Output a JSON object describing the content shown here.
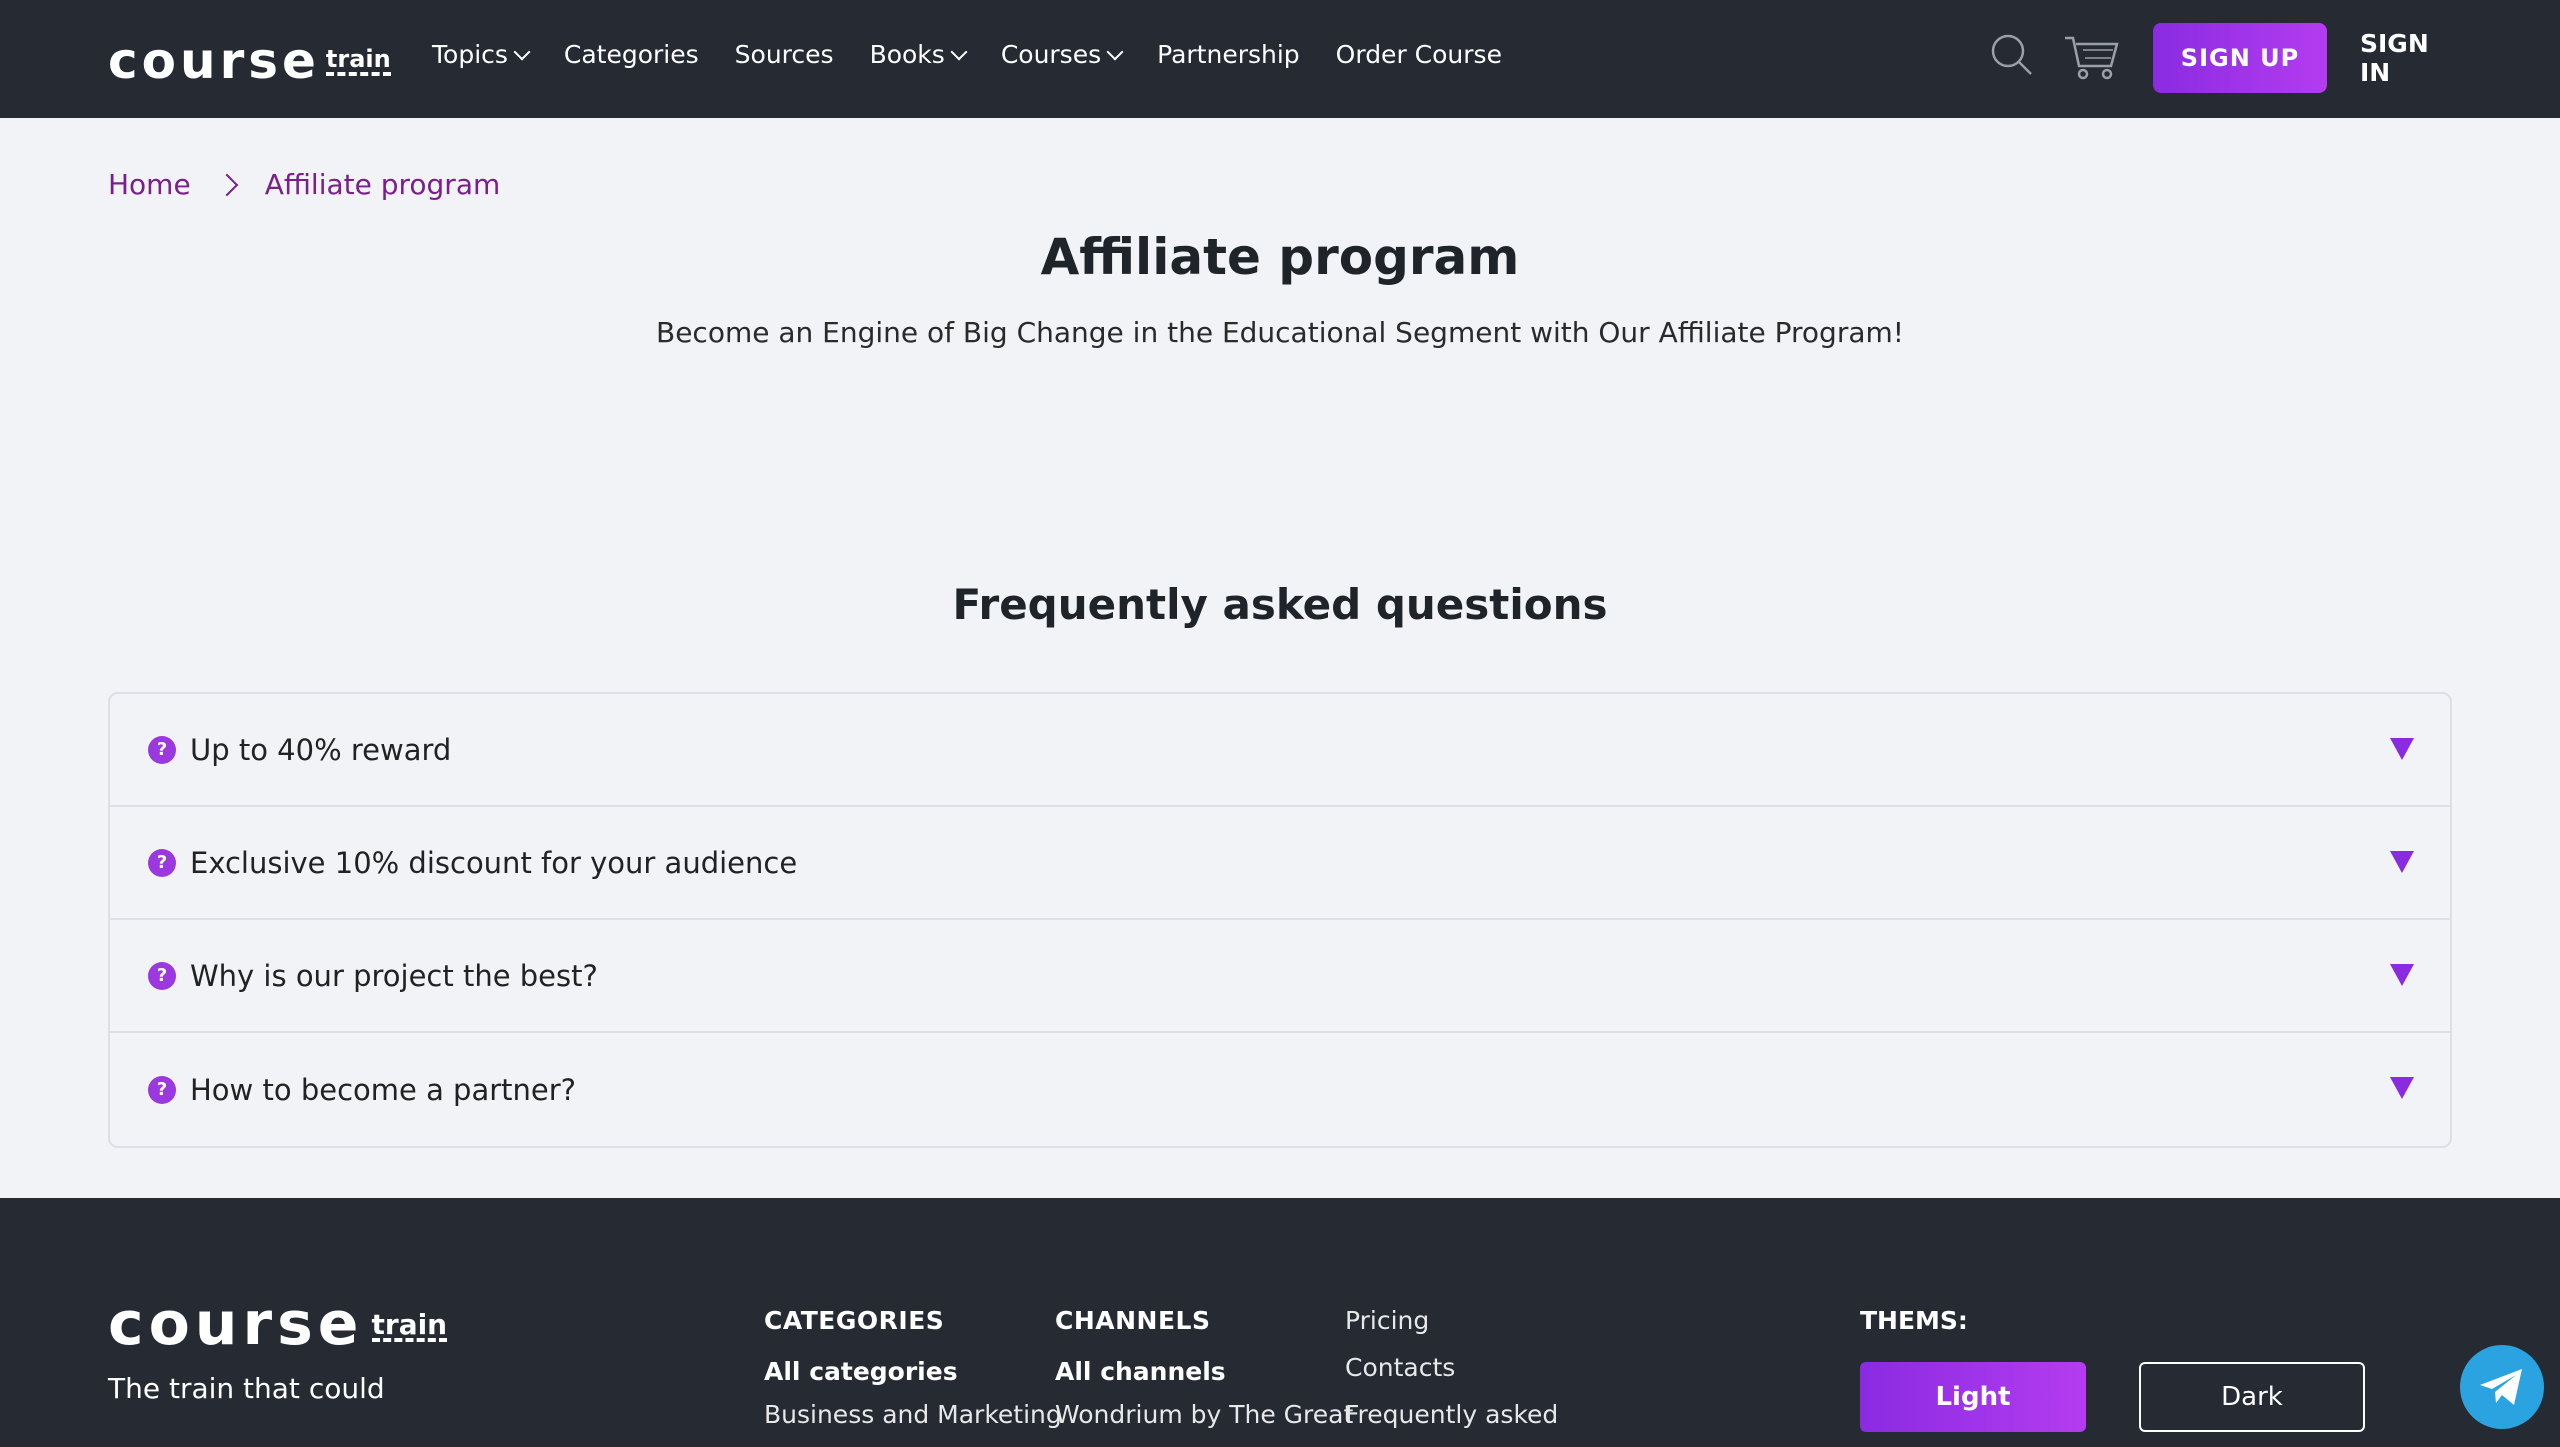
{
  "header": {
    "logo_word": "course",
    "logo_train": "train",
    "nav": [
      {
        "label": "Topics",
        "has_dropdown": true
      },
      {
        "label": "Categories",
        "has_dropdown": false
      },
      {
        "label": "Sources",
        "has_dropdown": false
      },
      {
        "label": "Books",
        "has_dropdown": true
      },
      {
        "label": "Courses",
        "has_dropdown": true
      },
      {
        "label": "Partnership",
        "has_dropdown": false
      },
      {
        "label": "Order Course",
        "has_dropdown": false
      }
    ],
    "search_icon": "search-icon",
    "cart_icon": "cart-icon",
    "signup_label": "SIGN UP",
    "signin_label": "SIGN IN"
  },
  "breadcrumb": {
    "home": "Home",
    "current": "Affiliate program"
  },
  "main": {
    "title": "Affiliate program",
    "subtitle": "Become an Engine of Big Change in the Educational Segment with Our Affiliate Program!",
    "faq_title": "Frequently asked questions",
    "faq": [
      {
        "question": "Up to 40% reward"
      },
      {
        "question": "Exclusive 10% discount for your audience"
      },
      {
        "question": "Why is our project the best?"
      },
      {
        "question": "How to become a partner?"
      }
    ]
  },
  "footer": {
    "logo_word": "course",
    "logo_train": "train",
    "tagline": "The train that could",
    "categories": {
      "heading": "CATEGORIES",
      "all": "All categories",
      "first": "Business and Marketing"
    },
    "channels": {
      "heading": "CHANNELS",
      "all": "All channels",
      "first": "Wondrium by The Great"
    },
    "links": [
      "Pricing",
      "Contacts",
      "Frequently asked"
    ],
    "thems_label": "THEMS:",
    "light_label": "Light",
    "dark_label": "Dark"
  },
  "colors": {
    "accent": "#9b38e0",
    "header_bg": "#252a33",
    "breadcrumb": "#7a1f8c",
    "telegram": "#2aa3e0"
  }
}
